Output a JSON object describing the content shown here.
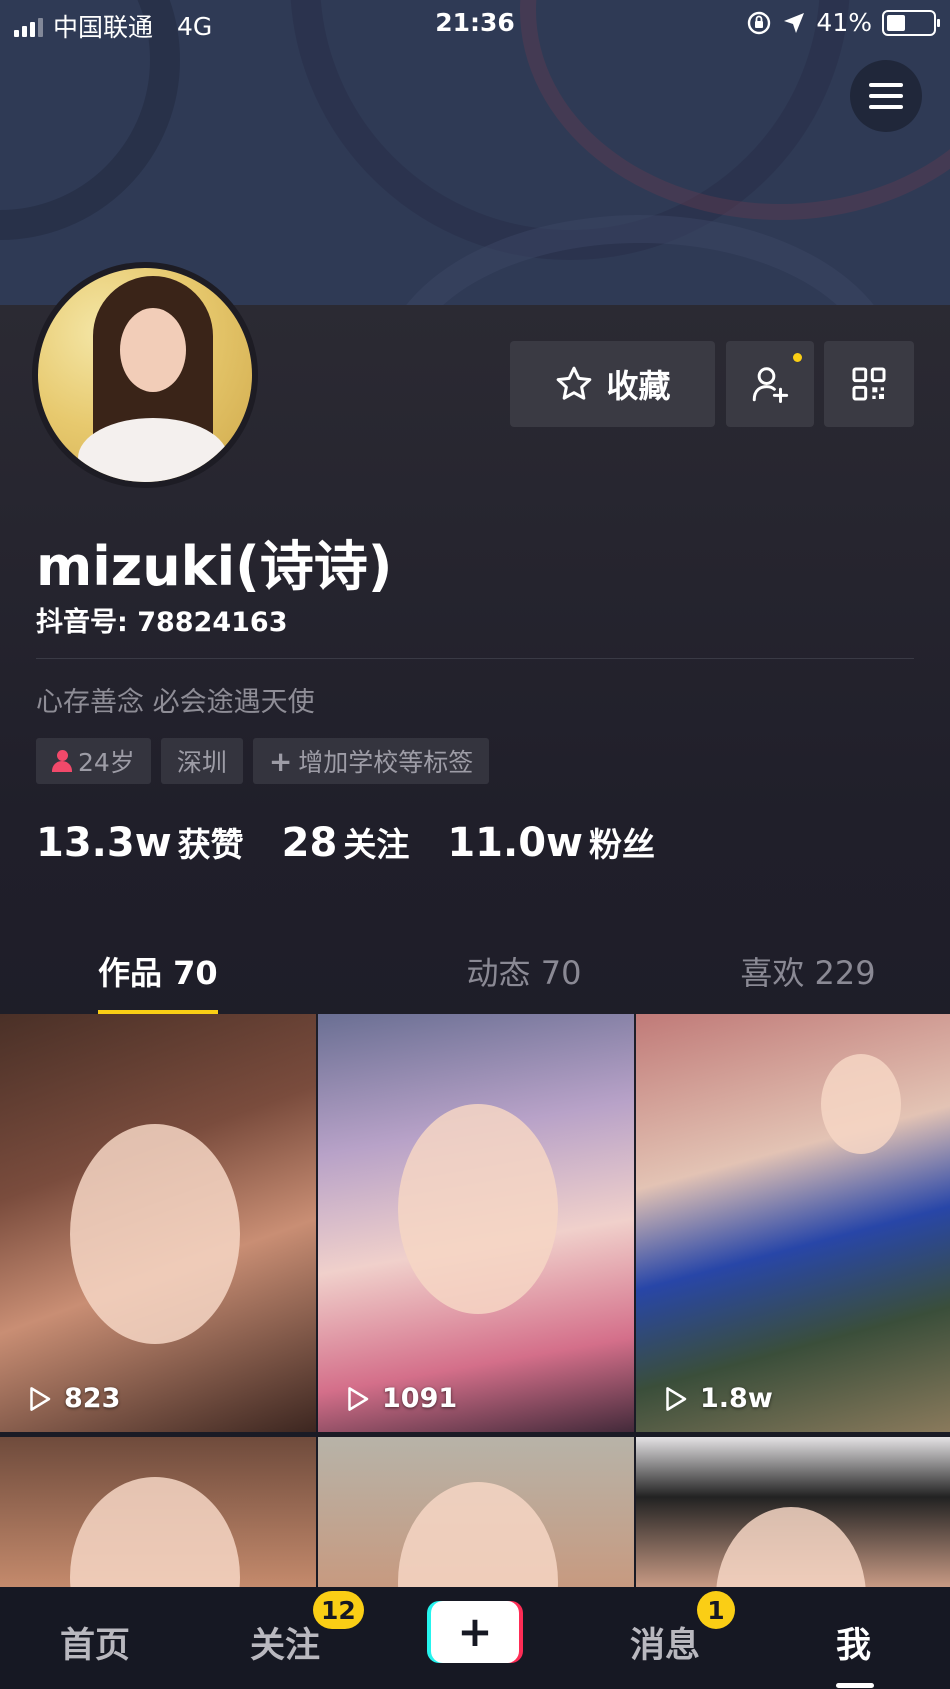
{
  "status_bar": {
    "carrier": "中国联通",
    "network": "4G",
    "time": "21:36",
    "battery_percent": "41%",
    "battery_level": 0.41
  },
  "header": {
    "menu_icon": "hamburger-menu-icon",
    "accent_color": "#face15"
  },
  "profile": {
    "nickname": "mizuki(诗诗)",
    "douyin_id": "抖音号: 78824163",
    "bio": "心存善念 必会途遇天使",
    "actions": {
      "collect_label": "收藏",
      "collect_icon": "star-icon",
      "add_friend_icon": "add-user-icon",
      "qr_icon": "qr-code-icon"
    },
    "tags": {
      "age": "24岁",
      "city": "深圳",
      "add_tag": "增加学校等标签"
    },
    "stats": {
      "likes_num": "13.3w",
      "likes_label": "获赞",
      "following_num": "28",
      "following_label": "关注",
      "followers_num": "11.0w",
      "followers_label": "粉丝"
    }
  },
  "tabs": {
    "works": "作品 70",
    "moments": "动态 70",
    "likes": "喜欢 229"
  },
  "videos": [
    {
      "plays": "823"
    },
    {
      "plays": "1091"
    },
    {
      "plays": "1.8w"
    }
  ],
  "bottom_nav": {
    "home": "首页",
    "following": "关注",
    "following_badge": "12",
    "create": "+",
    "messages": "消息",
    "messages_badge": "1",
    "me": "我"
  }
}
